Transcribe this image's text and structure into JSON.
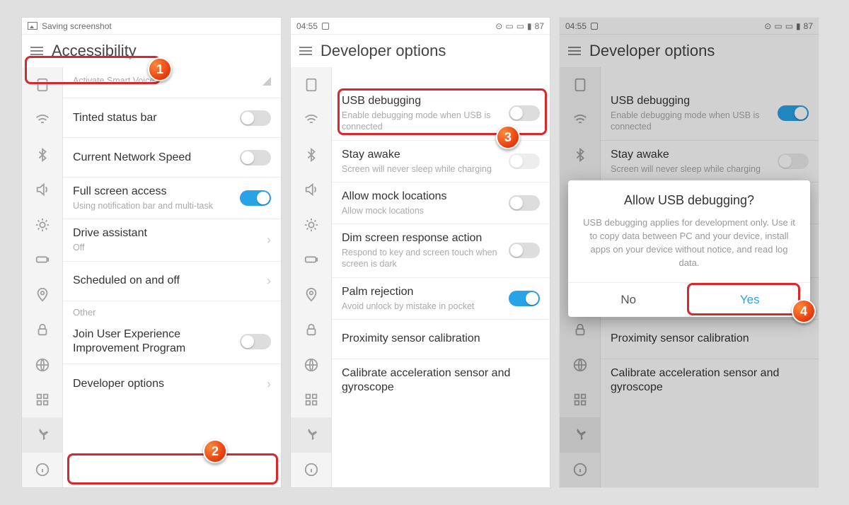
{
  "screen1": {
    "status_left": "Saving screenshot",
    "header_title": "Accessibility",
    "smart_voice_sub": "Activate Smart Voice",
    "rows": {
      "tinted": "Tinted status bar",
      "netspeed": "Current Network Speed",
      "fullscreen_t": "Full screen access",
      "fullscreen_s": "Using notification bar and multi-task",
      "drive_t": "Drive assistant",
      "drive_s": "Off",
      "sched": "Scheduled on and off",
      "other_label": "Other",
      "join_t": "Join User Experience Improvement Program",
      "devopt": "Developer options"
    }
  },
  "screen2": {
    "status_time": "04:55",
    "status_batt": "87",
    "header_title": "Developer options",
    "rows": {
      "usb_t": "USB debugging",
      "usb_s": "Enable debugging mode when USB is connected",
      "stay_t": "Stay awake",
      "stay_s": "Screen will never sleep while charging",
      "mock_t": "Allow mock locations",
      "mock_s": "Allow mock locations",
      "dim_t": "Dim screen response action",
      "dim_s": "Respond to key and screen touch when screen is dark",
      "palm_t": "Palm rejection",
      "palm_s": "Avoid unlock by mistake in pocket",
      "prox": "Proximity sensor calibration",
      "cal": "Calibrate acceleration sensor and gyroscope"
    }
  },
  "screen3": {
    "status_time": "04:55",
    "status_batt": "87",
    "header_title": "Developer options",
    "dialog": {
      "title": "Allow USB debugging?",
      "body": "USB debugging applies for development only. Use it to copy data between PC and your device, install apps on your device without notice, and read log data.",
      "no": "No",
      "yes": "Yes"
    }
  },
  "badges": {
    "b1": "1",
    "b2": "2",
    "b3": "3",
    "b4": "4"
  }
}
